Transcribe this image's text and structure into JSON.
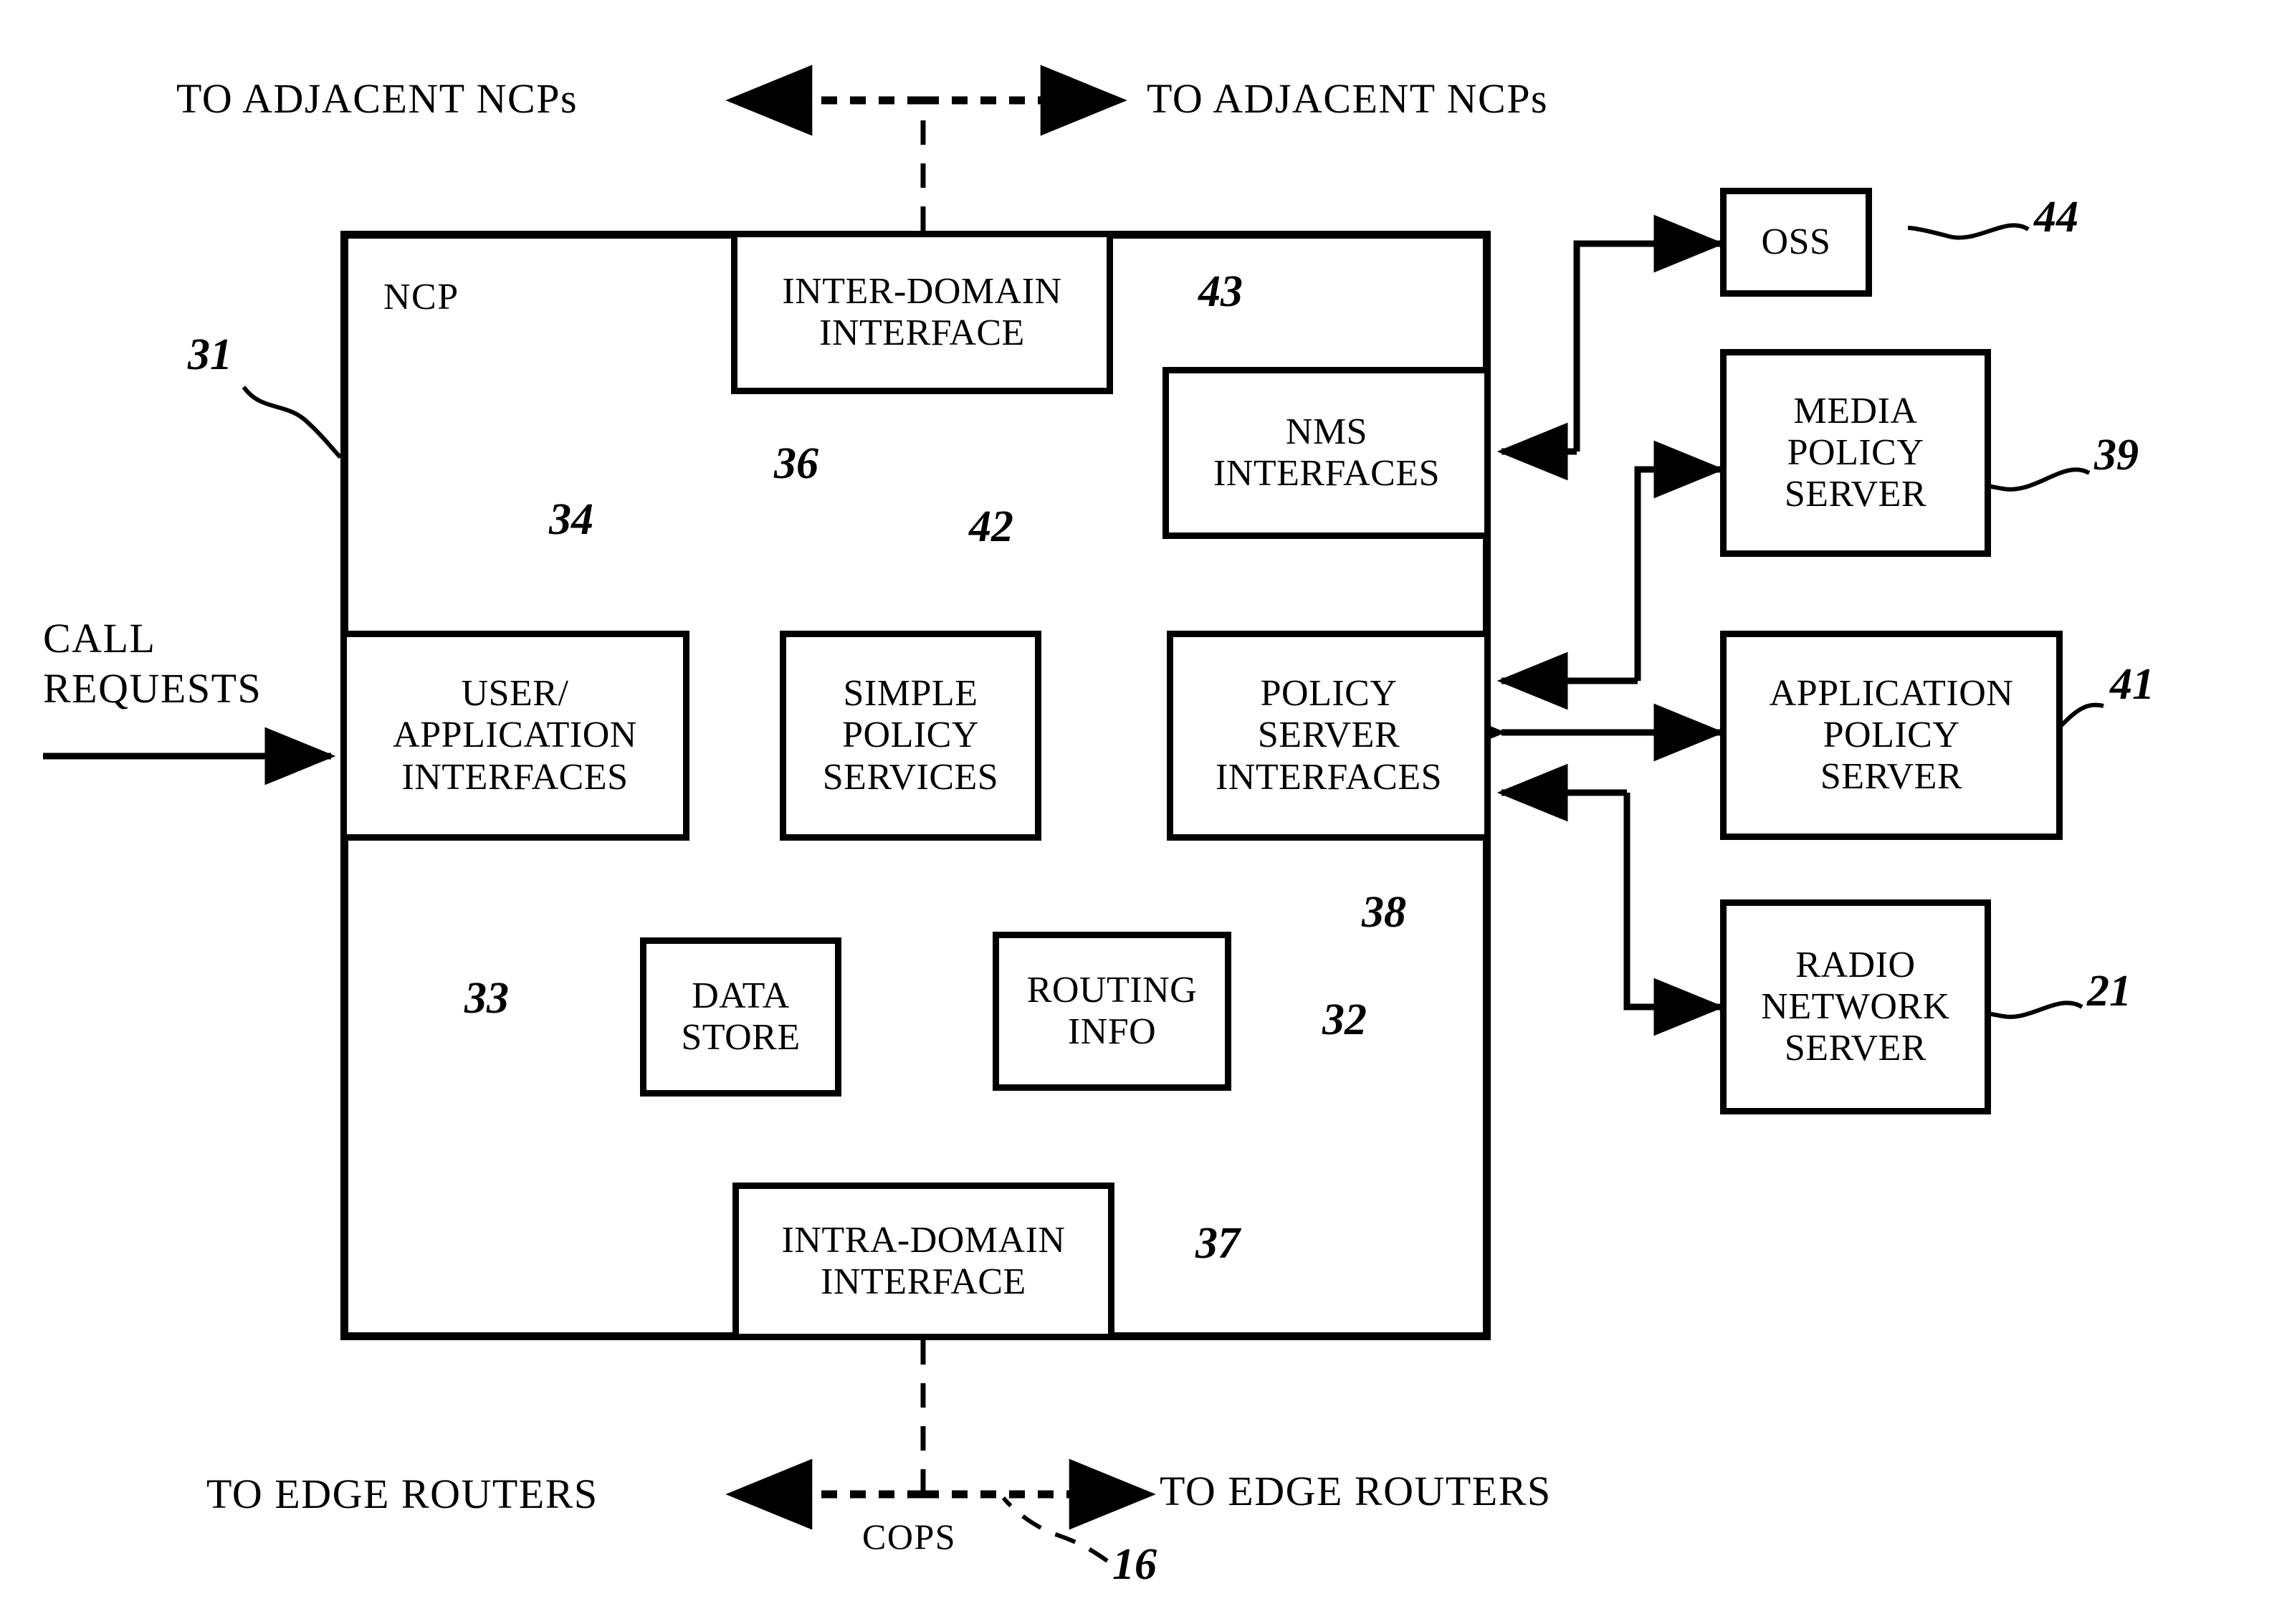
{
  "figure": {
    "type": "patent-block-diagram",
    "title_none": ""
  },
  "top_labels": {
    "left": "TO ADJACENT NCPs",
    "right": "TO ADJACENT NCPs"
  },
  "bottom_labels": {
    "left": "TO EDGE ROUTERS",
    "right": "TO EDGE ROUTERS",
    "protocol": "COPS"
  },
  "left_label": {
    "line1": "CALL",
    "line2": "REQUESTS"
  },
  "ncp": {
    "title": "NCP",
    "ref": "31",
    "blocks": [
      {
        "id": "inter_domain",
        "label": "INTER-DOMAIN\nINTERFACE",
        "ref": "36"
      },
      {
        "id": "nms",
        "label": "NMS\nINTERFACES",
        "ref": "43"
      },
      {
        "id": "user_app",
        "label": "USER/\nAPPLICATION\nINTERFACES",
        "ref": "34"
      },
      {
        "id": "simple_policy",
        "label": "SIMPLE\nPOLICY\nSERVICES",
        "ref": "42"
      },
      {
        "id": "policy_srv_if",
        "label": "POLICY\nSERVER\nINTERFACES",
        "ref": "38"
      },
      {
        "id": "data_store",
        "label": "DATA\nSTORE",
        "ref": "33"
      },
      {
        "id": "routing_info",
        "label": "ROUTING\nINFO",
        "ref": "32"
      },
      {
        "id": "intra_domain",
        "label": "INTRA-DOMAIN\nINTERFACE",
        "ref": "37"
      }
    ]
  },
  "external": [
    {
      "id": "oss",
      "label": "OSS",
      "ref": "44"
    },
    {
      "id": "media_ps",
      "label": "MEDIA\nPOLICY\nSERVER",
      "ref": "39"
    },
    {
      "id": "app_ps",
      "label": "APPLICATION\nPOLICY\nSERVER",
      "ref": "41"
    },
    {
      "id": "radio_ns",
      "label": "RADIO\nNETWORK\nSERVER",
      "ref": "21"
    }
  ],
  "cops_ref": "16",
  "colors": {
    "ink": "#000000",
    "paper": "#ffffff"
  }
}
